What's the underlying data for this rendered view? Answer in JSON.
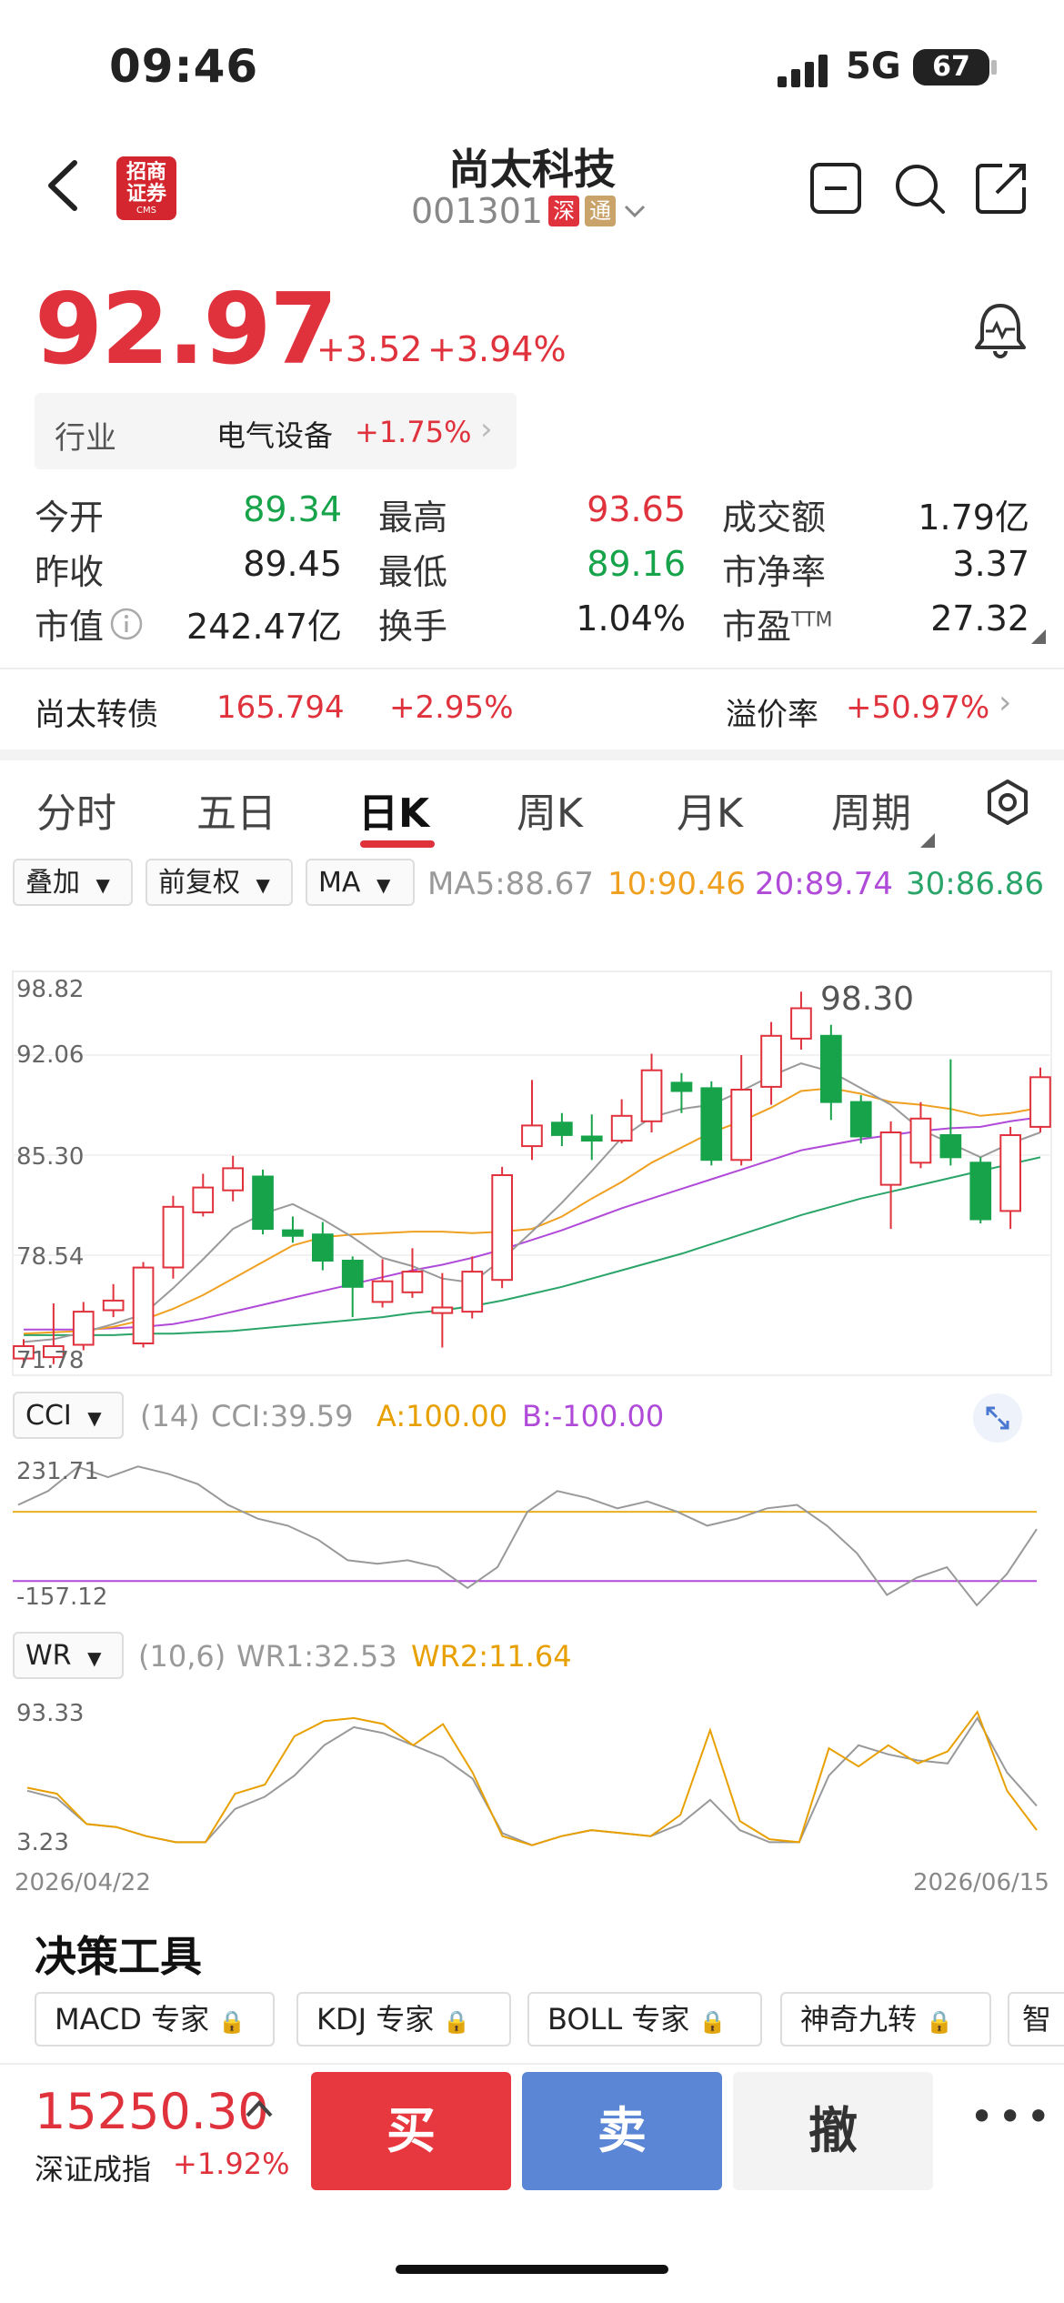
{
  "status_bar": {
    "time": "09:46",
    "network": "5G",
    "battery": "67"
  },
  "header": {
    "stock_name": "尚太科技",
    "stock_code": "001301",
    "tag_sz": "深",
    "tag_tong": "通",
    "logo_text_top": "招商",
    "logo_text_bottom": "证券",
    "logo_small": "CMS"
  },
  "price": {
    "last": "92.97",
    "change": "+3.52",
    "change_pct": "+3.94%"
  },
  "industry": {
    "label": "行业",
    "name": "电气设备",
    "pct": "+1.75%"
  },
  "quote": {
    "open_label": "今开",
    "open": "89.34",
    "high_label": "最高",
    "high": "93.65",
    "turnover_label": "成交额",
    "turnover": "1.79亿",
    "prev_close_label": "昨收",
    "prev_close": "89.45",
    "low_label": "最低",
    "low": "89.16",
    "pb_label": "市净率",
    "pb": "3.37",
    "mcap_label": "市值",
    "mcap": "242.47亿",
    "turnover_rate_label": "换手",
    "turnover_rate": "1.04%",
    "pe_label": "市盈",
    "pe_sup": "TTM",
    "pe": "27.32"
  },
  "bond": {
    "label": "尚太转债",
    "price": "165.794",
    "change": "+2.95%",
    "premium_label": "溢价率",
    "premium": "+50.97%"
  },
  "tabs": [
    "分时",
    "五日",
    "日K",
    "周K",
    "月K",
    "周期"
  ],
  "active_tab": "日K",
  "options": {
    "overlay": "叠加",
    "adjust": "前复权",
    "indicator": "MA"
  },
  "ma_legend": {
    "ma5": "MA5:88.67",
    "ma10": "10:90.46",
    "ma20": "20:89.74",
    "ma30": "30:86.86"
  },
  "colors": {
    "up": "#e0323c",
    "down": "#16a34a",
    "ma5": "#9a9a9a",
    "ma10": "#f0a020",
    "ma20": "#b04ad8",
    "ma30": "#2aa56a"
  },
  "chart_data": {
    "type": "candlestick",
    "y_ticks": [
      "98.82",
      "92.06",
      "85.30",
      "78.54",
      "71.78"
    ],
    "ylim": [
      71.78,
      98.82
    ],
    "peak_label": "98.30",
    "x_start": "2026/04/22",
    "x_end": "2026/06/15",
    "candles": [
      {
        "o": 72.2,
        "c": 73.1,
        "h": 73.6,
        "l": 71.9
      },
      {
        "o": 72.3,
        "c": 73.1,
        "h": 76.2,
        "l": 71.8
      },
      {
        "o": 73.2,
        "c": 75.6,
        "h": 76.3,
        "l": 72.8
      },
      {
        "o": 75.7,
        "c": 76.4,
        "h": 77.6,
        "l": 75.2
      },
      {
        "o": 73.3,
        "c": 78.8,
        "h": 79.2,
        "l": 73.0
      },
      {
        "o": 78.8,
        "c": 83.2,
        "h": 84.0,
        "l": 78.0
      },
      {
        "o": 82.8,
        "c": 84.6,
        "h": 85.6,
        "l": 82.5
      },
      {
        "o": 84.4,
        "c": 86.0,
        "h": 86.9,
        "l": 83.6
      },
      {
        "o": 85.4,
        "c": 81.6,
        "h": 85.9,
        "l": 81.2
      },
      {
        "o": 81.5,
        "c": 81.1,
        "h": 82.5,
        "l": 80.6
      },
      {
        "o": 81.2,
        "c": 79.3,
        "h": 82.1,
        "l": 78.6
      },
      {
        "o": 79.3,
        "c": 77.4,
        "h": 79.6,
        "l": 75.2
      },
      {
        "o": 76.3,
        "c": 77.8,
        "h": 79.4,
        "l": 75.9
      },
      {
        "o": 77.0,
        "c": 78.5,
        "h": 80.2,
        "l": 76.6
      },
      {
        "o": 75.5,
        "c": 75.9,
        "h": 78.4,
        "l": 73.0
      },
      {
        "o": 75.6,
        "c": 78.5,
        "h": 79.6,
        "l": 75.1
      },
      {
        "o": 77.9,
        "c": 85.5,
        "h": 86.1,
        "l": 77.3
      },
      {
        "o": 87.6,
        "c": 89.1,
        "h": 92.4,
        "l": 86.6
      },
      {
        "o": 89.3,
        "c": 88.4,
        "h": 90.0,
        "l": 87.6
      },
      {
        "o": 88.3,
        "c": 88.0,
        "h": 89.9,
        "l": 86.6
      },
      {
        "o": 88.0,
        "c": 89.8,
        "h": 91.0,
        "l": 87.8
      },
      {
        "o": 89.4,
        "c": 93.1,
        "h": 94.3,
        "l": 88.6
      },
      {
        "o": 92.2,
        "c": 91.6,
        "h": 92.9,
        "l": 90.0
      },
      {
        "o": 91.8,
        "c": 86.6,
        "h": 92.3,
        "l": 86.2
      },
      {
        "o": 86.6,
        "c": 91.7,
        "h": 94.2,
        "l": 86.2
      },
      {
        "o": 91.9,
        "c": 95.6,
        "h": 96.6,
        "l": 90.6
      },
      {
        "o": 95.4,
        "c": 97.6,
        "h": 98.8,
        "l": 94.6
      },
      {
        "o": 95.6,
        "c": 90.8,
        "h": 96.4,
        "l": 89.5
      },
      {
        "o": 90.8,
        "c": 88.3,
        "h": 91.3,
        "l": 87.8
      },
      {
        "o": 84.8,
        "c": 88.6,
        "h": 89.4,
        "l": 81.6
      },
      {
        "o": 86.4,
        "c": 89.6,
        "h": 90.8,
        "l": 86.0
      },
      {
        "o": 88.4,
        "c": 86.8,
        "h": 93.9,
        "l": 86.2
      },
      {
        "o": 86.4,
        "c": 82.3,
        "h": 86.8,
        "l": 82.0
      },
      {
        "o": 82.9,
        "c": 88.4,
        "h": 89.0,
        "l": 81.6
      },
      {
        "o": 89.0,
        "c": 92.6,
        "h": 93.3,
        "l": 88.6
      }
    ],
    "ma5": [
      73.4,
      73.6,
      74.1,
      74.7,
      75.4,
      77.3,
      79.4,
      81.6,
      82.7,
      83.4,
      82.3,
      81.0,
      79.5,
      78.9,
      78.0,
      77.7,
      79.4,
      81.4,
      83.5,
      85.8,
      88.2,
      89.7,
      90.3,
      90.6,
      91.6,
      92.7,
      93.6,
      93.0,
      91.8,
      90.6,
      88.8,
      87.8,
      86.8,
      87.8,
      88.6
    ],
    "ma10": [
      74.0,
      74.1,
      74.2,
      74.5,
      75.0,
      75.8,
      76.8,
      78.0,
      79.2,
      80.4,
      81.0,
      81.2,
      81.3,
      81.4,
      81.4,
      81.3,
      81.4,
      81.6,
      82.5,
      83.8,
      85.0,
      86.4,
      87.5,
      88.6,
      89.4,
      90.4,
      91.6,
      91.8,
      91.4,
      90.8,
      90.6,
      90.3,
      89.8,
      90.0,
      90.4
    ],
    "ma20": [
      74.3,
      74.3,
      74.3,
      74.4,
      74.5,
      74.7,
      75.1,
      75.6,
      76.1,
      76.6,
      77.1,
      77.6,
      78.1,
      78.6,
      79.0,
      79.5,
      80.1,
      80.8,
      81.5,
      82.3,
      83.1,
      83.8,
      84.5,
      85.2,
      85.9,
      86.6,
      87.3,
      87.7,
      88.1,
      88.4,
      88.7,
      88.9,
      89.0,
      89.4,
      89.7
    ],
    "ma30": [
      73.9,
      73.9,
      73.9,
      73.9,
      74.0,
      74.0,
      74.1,
      74.2,
      74.4,
      74.6,
      74.8,
      75.0,
      75.2,
      75.5,
      75.7,
      76.0,
      76.4,
      76.9,
      77.4,
      78.0,
      78.6,
      79.2,
      79.8,
      80.5,
      81.2,
      81.9,
      82.6,
      83.2,
      83.8,
      84.3,
      84.8,
      85.3,
      85.8,
      86.3,
      86.8
    ]
  },
  "cci": {
    "selector": "CCI",
    "legend_params": "(14)",
    "legend_value": "CCI:39.59",
    "legend_a": "A:100.00",
    "legend_b": "B:-100.00",
    "top_label": "231.71",
    "bottom_label": "-157.12",
    "ylim": [
      -157.12,
      231.71
    ],
    "a": 100,
    "b": -100,
    "values": [
      120,
      160,
      230,
      200,
      231,
      210,
      180,
      120,
      80,
      60,
      20,
      -40,
      -50,
      -40,
      -60,
      -120,
      -60,
      100,
      160,
      140,
      110,
      130,
      100,
      60,
      80,
      110,
      120,
      60,
      -20,
      -140,
      -90,
      -60,
      -170,
      -80,
      50
    ]
  },
  "wr": {
    "selector": "WR",
    "legend_params": "(10,6)",
    "legend_wr1": "WR1:32.53",
    "legend_wr2": "WR2:11.64",
    "top_label": "93.33",
    "bottom_label": "3.23",
    "ylim": [
      3.23,
      93.33
    ],
    "wr1": [
      40,
      35,
      18,
      16,
      10,
      6,
      6,
      28,
      36,
      50,
      70,
      82,
      78,
      70,
      62,
      48,
      12,
      4,
      10,
      14,
      12,
      10,
      18,
      34,
      14,
      6,
      6,
      50,
      70,
      64,
      60,
      58,
      88,
      52,
      30
    ],
    "wr2": [
      42,
      38,
      18,
      16,
      10,
      6,
      6,
      38,
      44,
      76,
      86,
      88,
      84,
      70,
      84,
      52,
      10,
      4,
      10,
      14,
      12,
      10,
      24,
      80,
      20,
      8,
      6,
      68,
      56,
      70,
      58,
      66,
      92,
      40,
      14
    ]
  },
  "decision": {
    "title": "决策工具",
    "tools": [
      "MACD 专家",
      "KDJ 专家",
      "BOLL 专家",
      "神奇九转",
      "智"
    ]
  },
  "bottom": {
    "index_value": "15250.30",
    "index_name": "深证成指",
    "index_pct": "+1.92%",
    "buy": "买",
    "sell": "卖",
    "cancel": "撤"
  }
}
